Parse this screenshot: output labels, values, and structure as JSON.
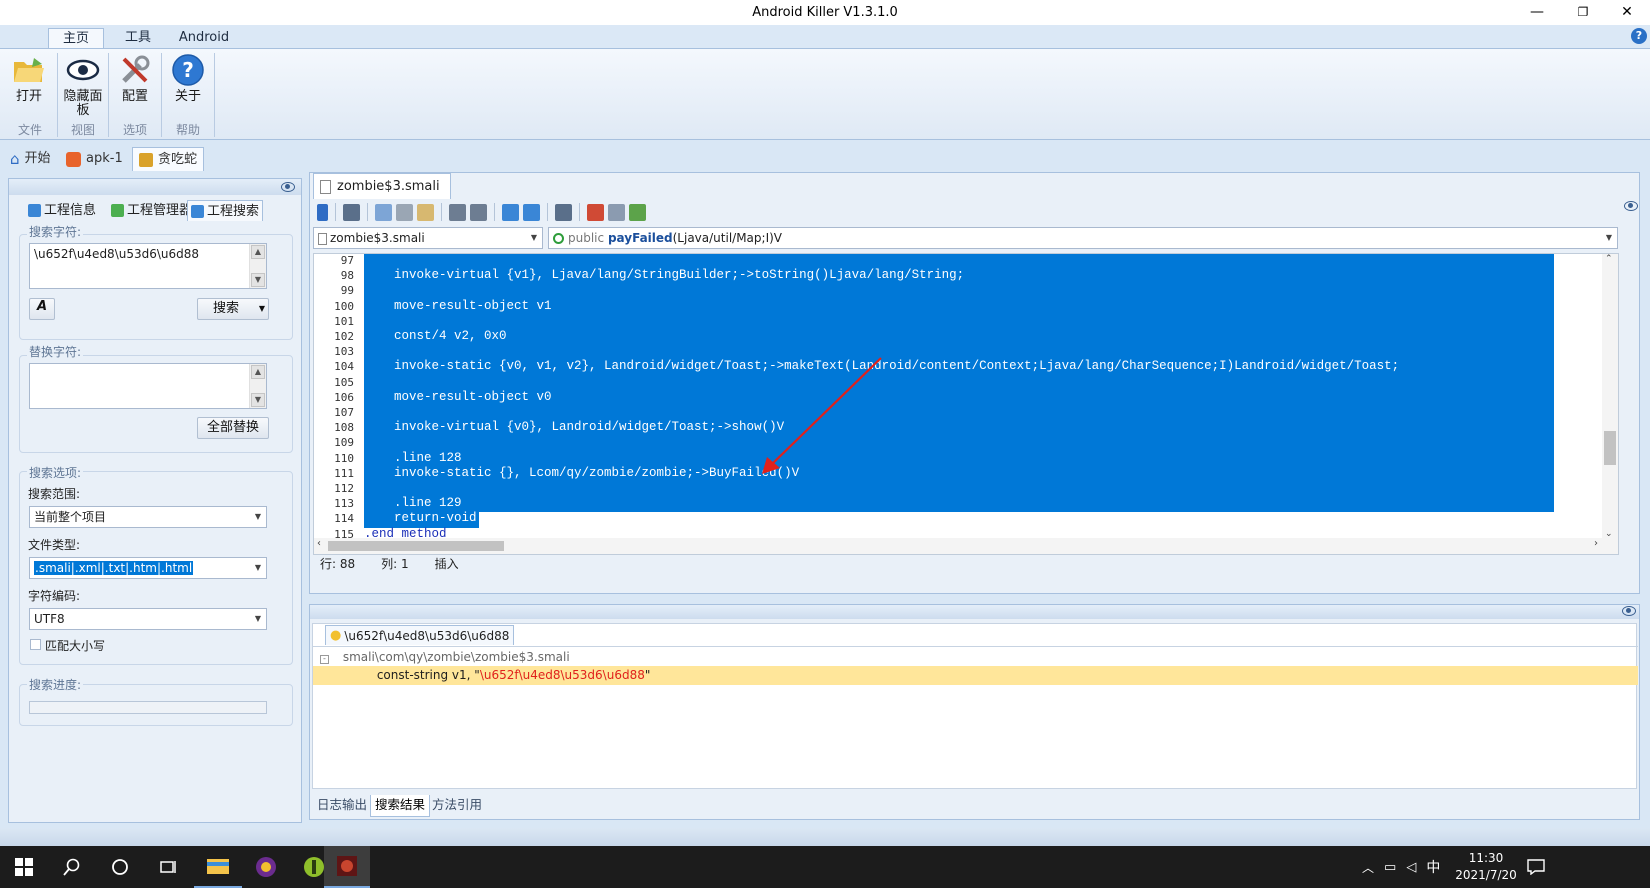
{
  "window": {
    "title": "Android Killer V1.3.1.0",
    "min": "—",
    "restore": "❐",
    "close": "✕"
  },
  "ribbon": {
    "tabs": [
      "主页",
      "工具",
      "Android"
    ],
    "help": "?",
    "buttons": [
      {
        "label": "打开",
        "group": "文件",
        "icon": "folder-open-icon"
      },
      {
        "label": "隐藏面板",
        "label2": "板",
        "group": "视图",
        "icon": "eye-icon"
      },
      {
        "label": "配置",
        "group": "选项",
        "icon": "tools-icon"
      },
      {
        "label": "关于",
        "group": "帮助",
        "icon": "help-icon"
      }
    ]
  },
  "doc_tabs": [
    {
      "label": "开始",
      "icon": "home-icon"
    },
    {
      "label": "apk-1",
      "icon": "apk-icon"
    },
    {
      "label": "贪吃蛇",
      "icon": "project-icon"
    }
  ],
  "left_panel": {
    "tabs": [
      "工程信息",
      "工程管理器",
      "工程搜索"
    ],
    "search_label": "搜索字符:",
    "search_value": "\\u652f\\u4ed8\\u53d6\\u6d88",
    "search_button": "搜索",
    "replace_label": "替换字符:",
    "replace_value": "",
    "replace_all_button": "全部替换",
    "options_label": "搜索选项:",
    "scope_label": "搜索范围:",
    "scope_value": "当前整个项目",
    "filetype_label": "文件类型:",
    "filetype_value": ".smali|.xml|.txt|.htm|.html",
    "encoding_label": "字符编码:",
    "encoding_value": "UTF8",
    "match_case_label": "匹配大小写",
    "progress_label": "搜索进度:",
    "progress": 0
  },
  "editor": {
    "file_tab": "zombie$3.smali",
    "file_combo": "zombie$3.smali",
    "method_combo": {
      "modifier": "public",
      "name": "payFailed",
      "sig": "(Ljava/util/Map;I)V"
    },
    "lines": [
      {
        "n": "97",
        "code": ""
      },
      {
        "n": "98",
        "code": "    invoke-virtual {v1}, Ljava/lang/StringBuilder;->toString()Ljava/lang/String;"
      },
      {
        "n": "99",
        "code": ""
      },
      {
        "n": "100",
        "code": "    move-result-object v1"
      },
      {
        "n": "101",
        "code": ""
      },
      {
        "n": "102",
        "code": "    const/4 v2, 0x0"
      },
      {
        "n": "103",
        "code": ""
      },
      {
        "n": "104",
        "code": "    invoke-static {v0, v1, v2}, Landroid/widget/Toast;->makeText(Landroid/content/Context;Ljava/lang/CharSequence;I)Landroid/widget/Toast;"
      },
      {
        "n": "105",
        "code": ""
      },
      {
        "n": "106",
        "code": "    move-result-object v0"
      },
      {
        "n": "107",
        "code": ""
      },
      {
        "n": "108",
        "code": "    invoke-virtual {v0}, Landroid/widget/Toast;->show()V"
      },
      {
        "n": "109",
        "code": ""
      },
      {
        "n": "110",
        "code": "    .line 128"
      },
      {
        "n": "111",
        "code": "    invoke-static {}, Lcom/qy/zombie/zombie;->BuyFailed()V"
      },
      {
        "n": "112",
        "code": ""
      },
      {
        "n": "113",
        "code": "    .line 129"
      },
      {
        "n": "114",
        "code": "    return-void"
      },
      {
        "n": "115",
        "code": ".end method"
      }
    ],
    "status": {
      "row": "行: 88",
      "col": "列: 1",
      "mode": "插入"
    }
  },
  "results": {
    "tab": "\\u652f\\u4ed8\\u53d6\\u6d88",
    "file": "smali\\com\\qy\\zombie\\zombie$3.smali",
    "match_prefix": "const-string v1, \"",
    "match_text": "\\u652f\\u4ed8\\u53d6\\u6d88",
    "match_suffix": "\"",
    "bottom_tabs": [
      "日志输出",
      "搜索结果",
      "方法引用"
    ]
  },
  "taskbar": {
    "time": "11:30",
    "date": "2021/7/20",
    "ime": "中"
  },
  "colors": {
    "selection": "#0078d7",
    "match_highlight": "#ffe69a",
    "match_text": "#e0211b",
    "arrow": "#e0211b"
  }
}
